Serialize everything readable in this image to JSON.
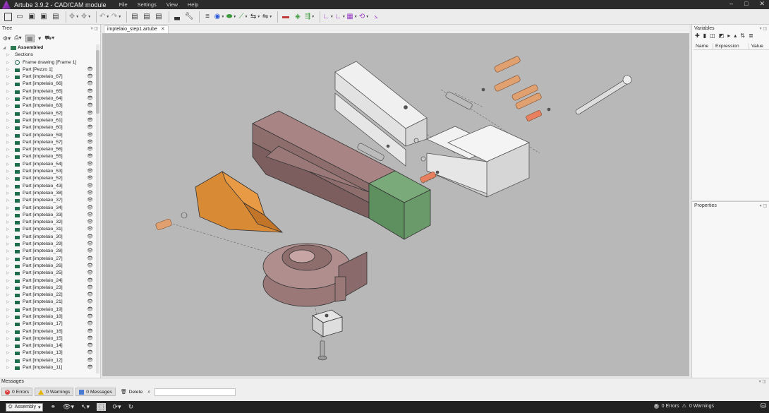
{
  "app": {
    "title": "Artube 3.9.2 - CAD/CAM module",
    "menu": [
      "File",
      "Settings",
      "View",
      "Help"
    ]
  },
  "tree": {
    "header": "Tree",
    "root": "Assembled",
    "items": [
      "Sections",
      "Frame drawing [Frame 1]",
      "Part [Pezzo 1]",
      "Part [imptelaio_67]",
      "Part [imptelaio_66]",
      "Part [imptelaio_65]",
      "Part [imptelaio_64]",
      "Part [imptelaio_63]",
      "Part [imptelaio_62]",
      "Part [imptelaio_61]",
      "Part [imptelaio_60]",
      "Part [imptelaio_59]",
      "Part [imptelaio_57]",
      "Part [imptelaio_56]",
      "Part [imptelaio_55]",
      "Part [imptelaio_54]",
      "Part [imptelaio_53]",
      "Part [imptelaio_52]",
      "Part [imptelaio_43]",
      "Part [imptelaio_38]",
      "Part [imptelaio_37]",
      "Part [imptelaio_34]",
      "Part [imptelaio_33]",
      "Part [imptelaio_32]",
      "Part [imptelaio_31]",
      "Part [imptelaio_30]",
      "Part [imptelaio_29]",
      "Part [imptelaio_28]",
      "Part [imptelaio_27]",
      "Part [imptelaio_26]",
      "Part [imptelaio_25]",
      "Part [imptelaio_24]",
      "Part [imptelaio_23]",
      "Part [imptelaio_22]",
      "Part [imptelaio_21]",
      "Part [imptelaio_19]",
      "Part [imptelaio_18]",
      "Part [imptelaio_17]",
      "Part [imptelaio_16]",
      "Part [imptelaio_15]",
      "Part [imptelaio_14]",
      "Part [imptelaio_13]",
      "Part [imptelaio_12]",
      "Part [imptelaio_11]"
    ]
  },
  "document": {
    "tab_label": "imptelaio_step1.artube"
  },
  "variables": {
    "header": "Variables",
    "columns": [
      "Name",
      "Expression",
      "Value"
    ]
  },
  "properties": {
    "header": "Properties"
  },
  "messages": {
    "header": "Messages",
    "errors": "0 Errors",
    "warnings": "0 Warnings",
    "messages": "0 Messages",
    "delete": "Delete",
    "search_value": ""
  },
  "statusbar": {
    "mode": "Assembly",
    "errors": "0 Errors",
    "warnings": "0 Warnings"
  },
  "colors": {
    "viewport_bg": "#b8b8b8",
    "orange_part": "#d88a35",
    "mauve_part": "#a07a7a",
    "green_part": "#6aa06a",
    "copper_part": "#d89a70"
  }
}
